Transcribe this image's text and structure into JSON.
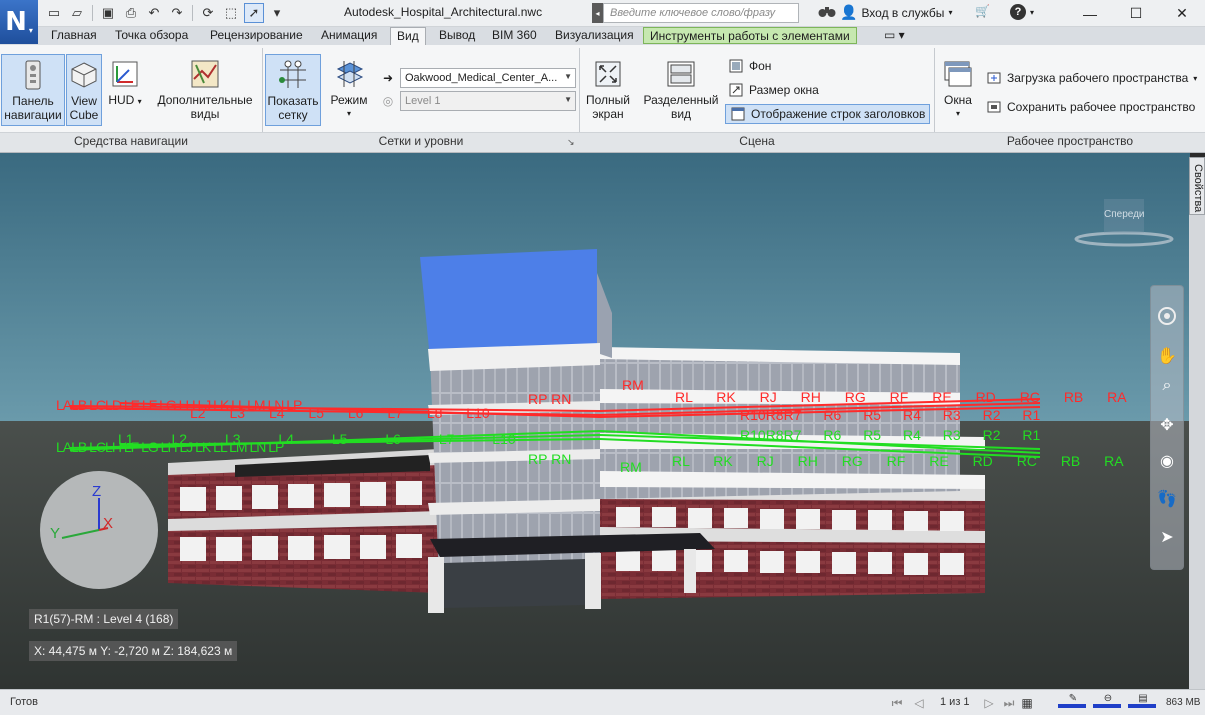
{
  "window": {
    "title": "Autodesk_Hospital_Architectural.nwc",
    "search_placeholder": "Введите ключевое слово/фразу",
    "signin_label": "Вход в службы",
    "minimize": "—",
    "maximize": "☐",
    "close": "✕"
  },
  "app_logo": "N",
  "tabs": [
    "Главная",
    "Точка обзора",
    "Рецензирование",
    "Анимация",
    "Вид",
    "Вывод",
    "BIM 360",
    "Визуализация",
    "Инструменты работы с элементами"
  ],
  "active_tab": "Вид",
  "ribbon": {
    "nav_tools": {
      "title": "Средства навигации",
      "nav_panel": "Панель навигации",
      "view_cube": "View Cube",
      "hud": "HUD",
      "extra_views": "Дополнительные виды"
    },
    "grids": {
      "title": "Сетки и уровни",
      "show_grid": "Показать сетку",
      "mode": "Режим",
      "model_combo": "Oakwood_Medical_Center_A...",
      "level_combo": "Level 1"
    },
    "scene": {
      "title": "Сцена",
      "full_screen": "Полный экран",
      "split_view": "Разделенный вид",
      "background": "Фон",
      "window_size": "Размер окна",
      "header_display": "Отображение строк заголовков"
    },
    "workspace": {
      "title": "Рабочее пространство",
      "windows": "Окна",
      "load_ws": "Загрузка рабочего пространства",
      "save_ws": "Сохранить рабочее пространство"
    }
  },
  "viewport": {
    "viewcube_label": "Спереди",
    "properties_tab": "Свойства",
    "grid_location": "R1(57)-RM : Level 4 (168)",
    "coords": "X: 44,475 м  Y: -2,720 м  Z: 184,623 м",
    "axis_x": "X",
    "axis_y": "Y",
    "axis_z": "Z",
    "grid_labels_red_left": [
      "LA",
      "LB",
      "LC",
      "LD",
      "LE",
      "LF",
      "LG",
      "LH",
      "LJ",
      "LK",
      "LL",
      "LM",
      "LN",
      "LP"
    ],
    "grid_labels_red_numbers": [
      "L2",
      "L3",
      "L4",
      "L5",
      "L6",
      "L7",
      "L8",
      "L10"
    ],
    "grid_labels_red_right": [
      "RM",
      "RL",
      "RK",
      "RJ",
      "RH",
      "RG",
      "RF",
      "RE",
      "RD",
      "RC",
      "RB",
      "RA",
      "RP",
      "RN"
    ],
    "grid_labels_red_rnum": [
      "R10",
      "R8",
      "R7",
      "R6",
      "R5",
      "R4",
      "R3",
      "R2",
      "R1"
    ],
    "grid_labels_green_left": [
      "LA",
      "LB",
      "LC",
      "LH",
      "LF",
      "LG",
      "LH",
      "LJ",
      "LK",
      "LL",
      "LM",
      "LN",
      "LP"
    ],
    "grid_labels_green_numbers": [
      "L1",
      "L2",
      "L3",
      "L4",
      "L5",
      "L6",
      "L7",
      "L10"
    ],
    "grid_labels_green_right": [
      "RM",
      "RL",
      "RK",
      "RJ",
      "RH",
      "RG",
      "RF",
      "RE",
      "RD",
      "RC",
      "RB",
      "RA",
      "RP",
      "RN"
    ],
    "grid_labels_green_rnum": [
      "R10",
      "R8",
      "R7",
      "R6",
      "R5",
      "R4",
      "R3",
      "R2",
      "R1"
    ],
    "colors": {
      "sky_top": "#3f6f86",
      "sky_bottom": "#5f8fa0",
      "ground": "#3a3f3c",
      "grid_red": "#ff2a2a",
      "grid_green": "#22dd22",
      "roof_blue": "#4d7fe8",
      "brick": "#7a2d35"
    }
  },
  "status": {
    "ready": "Готов",
    "page": "1 из 1",
    "memory": "863 MB"
  }
}
